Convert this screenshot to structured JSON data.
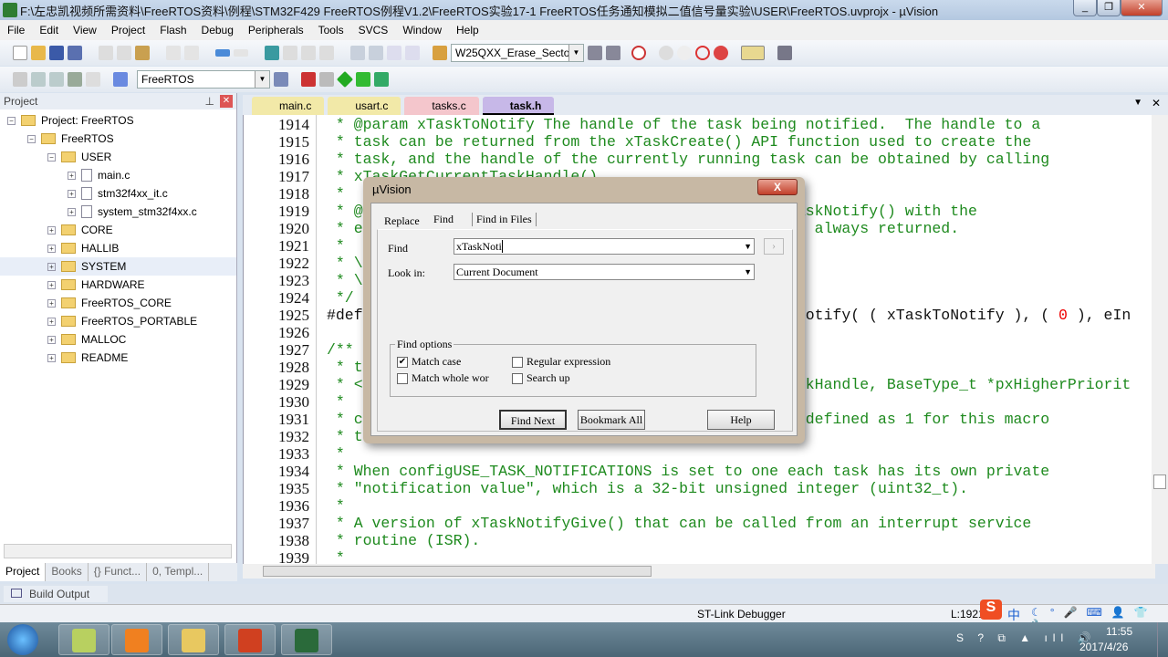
{
  "window": {
    "title": "F:\\左忠凯视频所需资料\\FreeRTOS资料\\例程\\STM32F429 FreeRTOS例程V1.2\\FreeRTOS实验17-1 FreeRTOS任务通知模拟二值信号量实验\\USER\\FreeRTOS.uvprojx - µVision"
  },
  "menu": [
    "File",
    "Edit",
    "View",
    "Project",
    "Flash",
    "Debug",
    "Peripherals",
    "Tools",
    "SVCS",
    "Window",
    "Help"
  ],
  "toolbar": {
    "find_combo": "W25QXX_Erase_Sector",
    "target_combo": "FreeRTOS"
  },
  "project": {
    "header": "Project",
    "tree": [
      {
        "label": "Project: FreeRTOS",
        "lvl": 0,
        "type": "root"
      },
      {
        "label": "FreeRTOS",
        "lvl": 1,
        "type": "folder"
      },
      {
        "label": "USER",
        "lvl": 2,
        "type": "folder"
      },
      {
        "label": "main.c",
        "lvl": 3,
        "type": "file"
      },
      {
        "label": "stm32f4xx_it.c",
        "lvl": 3,
        "type": "file"
      },
      {
        "label": "system_stm32f4xx.c",
        "lvl": 3,
        "type": "file"
      },
      {
        "label": "CORE",
        "lvl": 2,
        "type": "folder"
      },
      {
        "label": "HALLIB",
        "lvl": 2,
        "type": "folder"
      },
      {
        "label": "SYSTEM",
        "lvl": 2,
        "type": "folder"
      },
      {
        "label": "HARDWARE",
        "lvl": 2,
        "type": "folder"
      },
      {
        "label": "FreeRTOS_CORE",
        "lvl": 2,
        "type": "folder"
      },
      {
        "label": "FreeRTOS_PORTABLE",
        "lvl": 2,
        "type": "folder"
      },
      {
        "label": "MALLOC",
        "lvl": 2,
        "type": "folder"
      },
      {
        "label": "README",
        "lvl": 2,
        "type": "folder"
      }
    ],
    "tabs": [
      "Project",
      "Books",
      "{} Funct...",
      "0, Templ..."
    ]
  },
  "editor": {
    "tabs": [
      {
        "label": "main.c",
        "color": "#f2e9a8"
      },
      {
        "label": "usart.c",
        "color": "#f2e9a8"
      },
      {
        "label": "tasks.c",
        "color": "#f4c6cc"
      },
      {
        "label": "task.h",
        "color": "#c7b8e8",
        "active": true
      }
    ],
    "lines": [
      {
        "n": "1914",
        "s": [
          {
            "t": " * @param xTaskToNotify The handle of the task being notified.  The handle to a",
            "k": "comment"
          }
        ]
      },
      {
        "n": "1915",
        "s": [
          {
            "t": " * task can be returned from the xTaskCreate() API function used to create the",
            "k": "comment"
          }
        ]
      },
      {
        "n": "1916",
        "s": [
          {
            "t": " * task, and the handle of the currently running task can be obtained by calling",
            "k": "comment"
          }
        ]
      },
      {
        "n": "1917",
        "s": [
          {
            "t": " * xTaskGetCurrentTaskHandle()",
            "k": "comment"
          }
        ]
      },
      {
        "n": "1918",
        "s": [
          {
            "t": " *",
            "k": "comment"
          }
        ]
      },
      {
        "n": "1919",
        "s": [
          {
            "t": " * @                                                askNotify() with the",
            "k": "comment"
          }
        ]
      },
      {
        "n": "1920",
        "s": [
          {
            "t": " * e                                                  always returned.",
            "k": "comment"
          }
        ]
      },
      {
        "n": "1921",
        "s": [
          {
            "t": " *",
            "k": "comment"
          }
        ]
      },
      {
        "n": "1922",
        "s": [
          {
            "t": " * \\",
            "k": "comment"
          }
        ]
      },
      {
        "n": "1923",
        "s": [
          {
            "t": " * \\",
            "k": "comment"
          }
        ]
      },
      {
        "n": "1924",
        "s": [
          {
            "t": " */",
            "k": "comment"
          }
        ]
      },
      {
        "n": "1925",
        "s": [
          {
            "t": "#def                                                Notify( ( xTaskToNotify ), ( ",
            "k": "code"
          },
          {
            "t": "0",
            "k": "num"
          },
          {
            "t": " ), eIn",
            "k": "code"
          }
        ]
      },
      {
        "n": "1926",
        "s": []
      },
      {
        "n": "1927",
        "s": [
          {
            "t": "/**",
            "k": "comment"
          }
        ]
      },
      {
        "n": "1928",
        "s": [
          {
            "t": " * t",
            "k": "comment"
          }
        ]
      },
      {
        "n": "1929",
        "s": [
          {
            "t": " * <                                                skHandle, BaseType_t *pxHigherPriorit",
            "k": "comment"
          }
        ]
      },
      {
        "n": "1930",
        "s": [
          {
            "t": " *",
            "k": "comment"
          }
        ]
      },
      {
        "n": "1931",
        "s": [
          {
            "t": " * c                                                 defined as 1 for this macro",
            "k": "comment"
          }
        ]
      },
      {
        "n": "1932",
        "s": [
          {
            "t": " * t",
            "k": "comment"
          }
        ]
      },
      {
        "n": "1933",
        "s": [
          {
            "t": " *",
            "k": "comment"
          }
        ]
      },
      {
        "n": "1934",
        "s": [
          {
            "t": " * When configUSE_TASK_NOTIFICATIONS is set to one each task has its own private",
            "k": "comment"
          }
        ]
      },
      {
        "n": "1935",
        "s": [
          {
            "t": " * \"notification value\", which is a 32-bit unsigned integer (uint32_t).",
            "k": "comment"
          }
        ]
      },
      {
        "n": "1936",
        "s": [
          {
            "t": " *",
            "k": "comment"
          }
        ]
      },
      {
        "n": "1937",
        "s": [
          {
            "t": " * A version of xTaskNotifyGive() that can be called from an interrupt service",
            "k": "comment"
          }
        ]
      },
      {
        "n": "1938",
        "s": [
          {
            "t": " * routine (ISR).",
            "k": "comment"
          }
        ]
      },
      {
        "n": "1939",
        "s": [
          {
            "t": " *",
            "k": "comment"
          }
        ]
      }
    ]
  },
  "dialog": {
    "title": "µVision",
    "close": "X",
    "tabs": [
      "Replace",
      "Find",
      "Find in Files"
    ],
    "find_label": "Find",
    "find_value": "xTaskNoti",
    "lookin_label": "Look in:",
    "lookin_value": "Current Document",
    "options_title": "Find options",
    "options": [
      {
        "label": "Match case",
        "checked": true
      },
      {
        "label": "Regular expression",
        "checked": false
      },
      {
        "label": "Match whole wor",
        "checked": false
      },
      {
        "label": "Search up",
        "checked": false
      }
    ],
    "find_next": "Find Next",
    "bookmark_all": "Bookmark All",
    "help": "Help"
  },
  "build_output": "Build Output",
  "status": {
    "debugger": "ST-Link Debugger",
    "line": "L:1921",
    "ime": "中"
  },
  "taskbar": {
    "time": "11:55",
    "date": "2017/4/26",
    "apps": [
      "notepad++",
      "foxit-pdf",
      "explorer",
      "powerpoint",
      "keil-uvision5"
    ]
  }
}
